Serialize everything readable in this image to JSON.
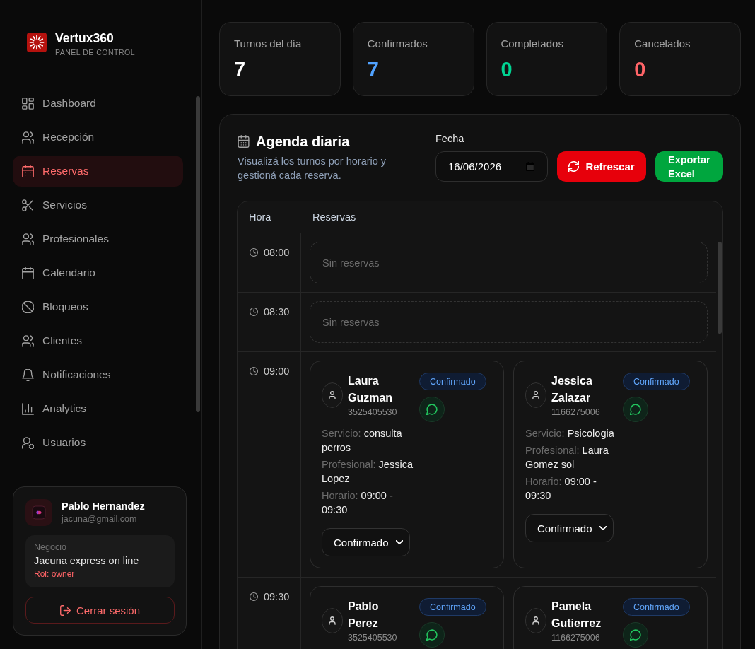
{
  "brand": {
    "name": "Vertux360",
    "subtitle": "PANEL DE CONTROL"
  },
  "nav": [
    {
      "label": "Dashboard",
      "selected": false
    },
    {
      "label": "Recepción",
      "selected": false
    },
    {
      "label": "Reservas",
      "selected": true
    },
    {
      "label": "Servicios",
      "selected": false
    },
    {
      "label": "Profesionales",
      "selected": false
    },
    {
      "label": "Calendario",
      "selected": false
    },
    {
      "label": "Bloqueos",
      "selected": false
    },
    {
      "label": "Clientes",
      "selected": false
    },
    {
      "label": "Notificaciones",
      "selected": false
    },
    {
      "label": "Analytics",
      "selected": false
    },
    {
      "label": "Usuarios",
      "selected": false
    }
  ],
  "user": {
    "name": "Pablo Hernandez",
    "email": "jacuna@gmail.com",
    "business_label": "Negocio",
    "business": "Jacuna express on line",
    "role": "Rol: owner",
    "logout": "Cerrar sesión"
  },
  "stats": [
    {
      "label": "Turnos del día",
      "value": "7",
      "color": "#ffffff"
    },
    {
      "label": "Confirmados",
      "value": "7",
      "color": "#51a2ff"
    },
    {
      "label": "Completados",
      "value": "0",
      "color": "#00d492"
    },
    {
      "label": "Cancelados",
      "value": "0",
      "color": "#ff6467"
    }
  ],
  "agenda": {
    "title": "Agenda diaria",
    "subtitle": "Visualizá los turnos por horario y gestioná cada reserva.",
    "date_label": "Fecha",
    "date": "16/06/2026",
    "refresh": "Refrescar",
    "export": "Exportar Excel",
    "columns": [
      "Hora",
      "Reservas"
    ],
    "slots": [
      {
        "time": "08:00",
        "empty": "Sin reservas"
      },
      {
        "time": "08:30",
        "empty": "Sin reservas"
      },
      {
        "time": "09:00",
        "bookings": [
          {
            "name": "Laura Guzman",
            "phone": "3525405530",
            "badge": "Confirmado",
            "details": [
              {
                "label": "Servicio:",
                "value": "consulta perros"
              },
              {
                "label": "Profesional:",
                "value": "Jessica Lopez"
              },
              {
                "label": "Horario:",
                "value": "09:00 - 09:30"
              }
            ],
            "select": "Confirmado"
          },
          {
            "name": "Jessica Zalazar",
            "phone": "1166275006",
            "badge": "Confirmado",
            "details": [
              {
                "label": "Servicio:",
                "value": "Psicologia"
              },
              {
                "label": "Profesional:",
                "value": "Laura Gomez sol"
              },
              {
                "label": "Horario:",
                "value": "09:00 - 09:30"
              }
            ],
            "select": "Confirmado"
          }
        ]
      },
      {
        "time": "09:30",
        "bookings": [
          {
            "name": "Pablo Perez",
            "phone": "3525405530",
            "badge": "Confirmado"
          },
          {
            "name": "Pamela Gutierrez",
            "phone": "1166275006",
            "badge": "Confirmado"
          }
        ]
      }
    ]
  }
}
